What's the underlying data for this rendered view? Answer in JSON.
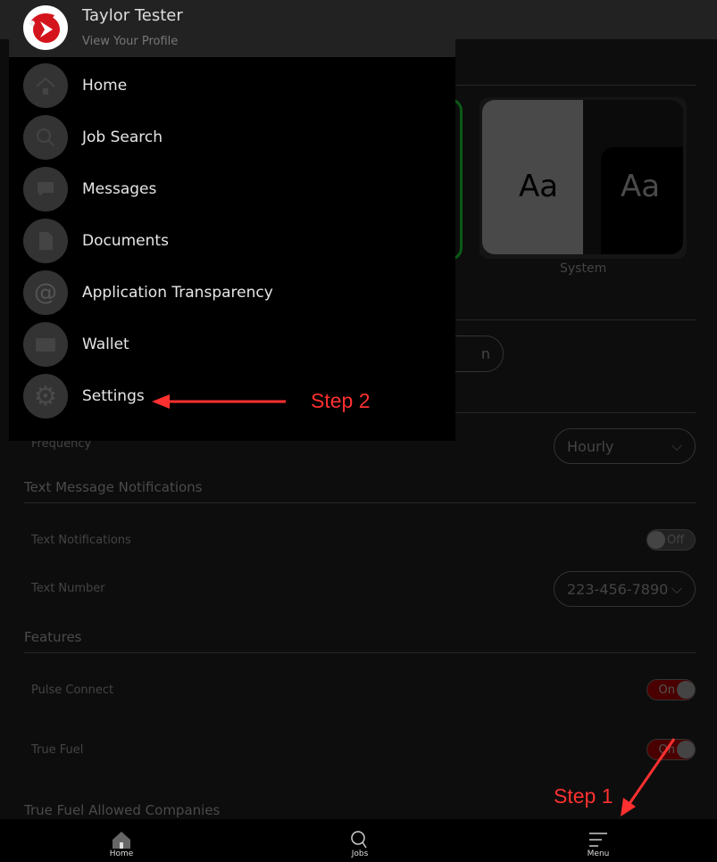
{
  "profile": {
    "name": "Taylor Tester",
    "subtitle": "View Your Profile"
  },
  "menu": [
    {
      "label": "Home",
      "icon": "home-icon"
    },
    {
      "label": "Job Search",
      "icon": "search-icon"
    },
    {
      "label": "Messages",
      "icon": "message-icon"
    },
    {
      "label": "Documents",
      "icon": "document-icon"
    },
    {
      "label": "Application Transparency",
      "icon": "at-icon"
    },
    {
      "label": "Wallet",
      "icon": "wallet-icon"
    },
    {
      "label": "Settings",
      "icon": "gear-icon"
    }
  ],
  "background": {
    "theme_sample": "Aa",
    "theme_system": "System",
    "pill_partial": "n",
    "frequency_label": "Frequency",
    "frequency_value": "Hourly",
    "text_section": "Text Message Notifications",
    "text_notifications_label": "Text Notifications",
    "text_notifications_state": "Off",
    "text_number_label": "Text Number",
    "text_number_value": "223-456-7890",
    "features_section": "Features",
    "pulse_connect_label": "Pulse Connect",
    "pulse_connect_state": "On",
    "true_fuel_label": "True Fuel",
    "true_fuel_state": "On",
    "true_fuel_companies": "True Fuel Allowed Companies"
  },
  "bottom_nav": [
    {
      "label": "Home"
    },
    {
      "label": "Jobs"
    },
    {
      "label": "Menu"
    }
  ],
  "annotations": {
    "step1": "Step 1",
    "step2": "Step 2",
    "color": "#ff3030"
  },
  "colors": {
    "toggle_on": "#4a0000",
    "accent_selected": "#0a6a1a"
  }
}
